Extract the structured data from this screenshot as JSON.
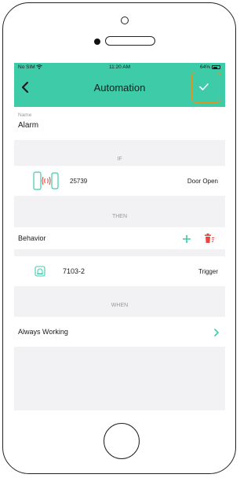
{
  "status_bar": {
    "carrier": "No SIM",
    "time": "11:20 AM",
    "battery": "64%"
  },
  "header": {
    "title": "Automation"
  },
  "name_field": {
    "label": "Name",
    "value": "Alarm"
  },
  "if_section": {
    "label": "IF",
    "condition": {
      "device_id": "25739",
      "state": "Door Open",
      "icon": "door-sensor-icon"
    }
  },
  "then_section": {
    "label": "THEN",
    "behavior_label": "Behavior",
    "action": {
      "device_id": "7103-2",
      "command": "Trigger",
      "icon": "siren-icon"
    }
  },
  "when_section": {
    "label": "WHEN",
    "schedule": "Always Working"
  },
  "colors": {
    "accent": "#3ecba8",
    "delete": "#e8473f",
    "highlight": "#e0921e"
  }
}
